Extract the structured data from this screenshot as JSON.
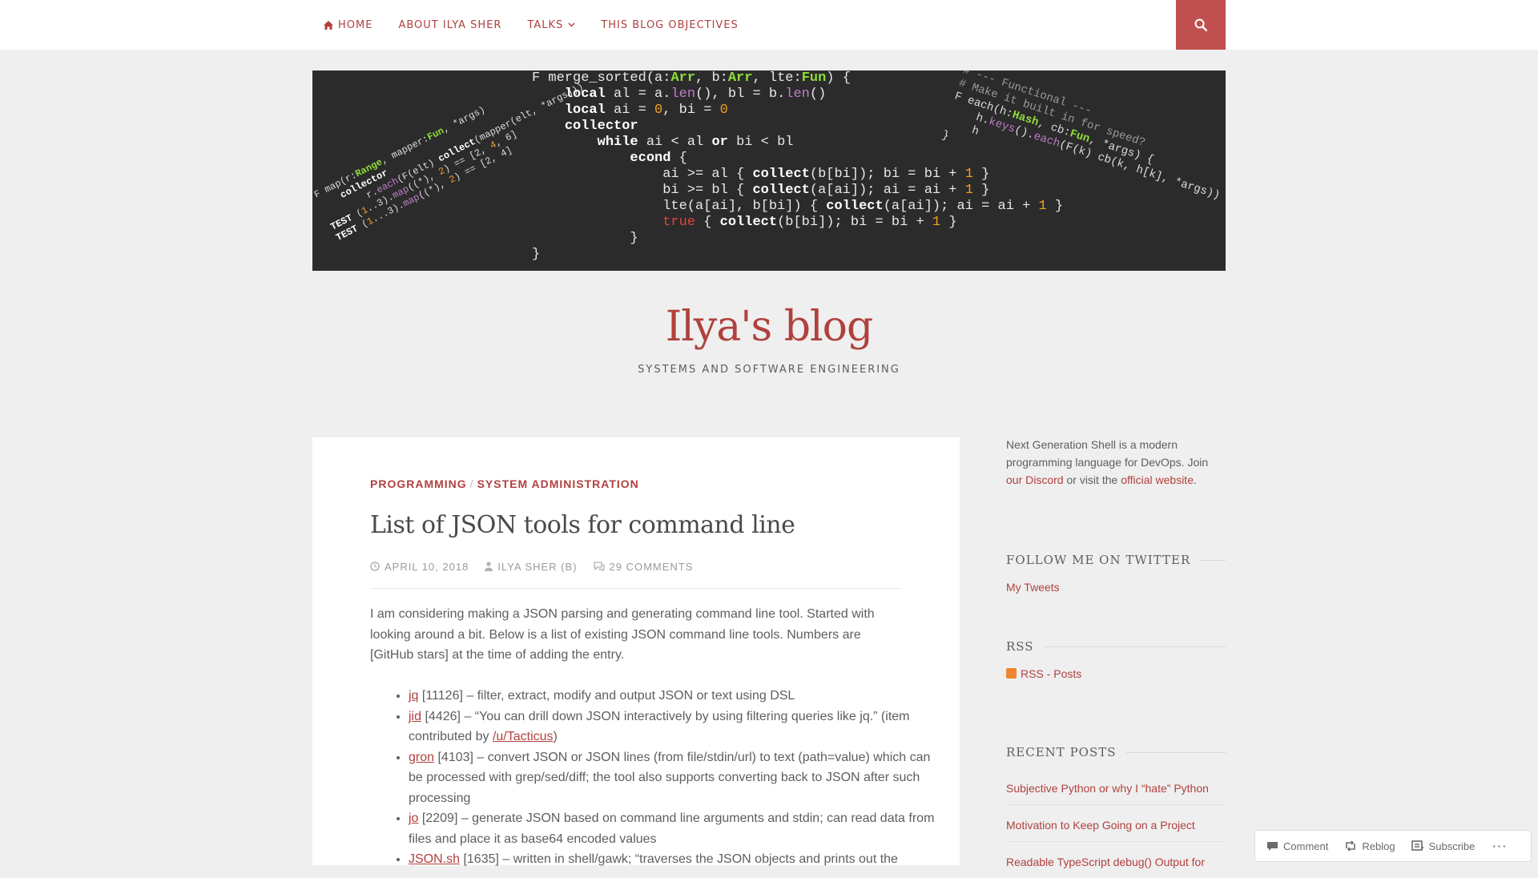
{
  "nav": {
    "items": [
      {
        "icon": "home-icon",
        "label": "HOME"
      },
      {
        "label": "ABOUT ILYA SHER"
      },
      {
        "label": "TALKS"
      },
      {
        "label": "THIS BLOG OBJECTIVES"
      }
    ],
    "search_icon": "search-icon"
  },
  "header_code": {
    "main": [
      "F merge_sorted(a:Arr, b:Arr, lte:Fun) {",
      "    local al = a.len(), bl = b.len()",
      "    local ai = 0, bi = 0",
      "    collector",
      "        while ai < al or bi < bl",
      "            econd {",
      "                ai >= al { collect(b[bi]); bi = bi + 1 }",
      "                bi >= bl { collect(a[ai]); ai = ai + 1 }",
      "                lte(a[ai], b[bi]) { collect(a[ai]); ai = ai + 1 }",
      "                true { collect(b[bi]); bi = bi + 1 }",
      "            }",
      "}"
    ],
    "left": [
      "F map(r:Range, mapper:Fun, *args)",
      "    collector",
      "        r.each(F(elt) collect(mapper(elt, *args)))",
      "TEST (1..3).map((*), 2) == [2, 4, 6]",
      "TEST (1...3).map((*), 2) == [2, 4]"
    ],
    "right": [
      "# --- Functional ---",
      "# Make it built in for speed?",
      "F each(h:Hash, cb:Fun, *args) {",
      "    h.keys().each(F(k) cb(k, h[k], *args))",
      "    h",
      "}"
    ]
  },
  "site": {
    "title": "Ilya's blog",
    "tagline": "SYSTEMS AND SOFTWARE ENGINEERING"
  },
  "post": {
    "categories": [
      "PROGRAMMING",
      "SYSTEM ADMINISTRATION"
    ],
    "category_separator": "/",
    "title": "List of JSON tools for command line",
    "date": "APRIL 10, 2018",
    "author": "ILYA SHER (B)",
    "comments": "29 COMMENTS",
    "intro": "I am considering making a JSON parsing and generating command line tool. Started with looking around a bit. Below is a list of existing JSON command line tools. Numbers are [GitHub stars] at the time of adding the entry.",
    "tools": [
      {
        "name": "jq",
        "text": " [11126] – filter, extract, modify and output JSON or text using DSL"
      },
      {
        "name": "jid",
        "text": " [4426] – “You can drill down JSON interactively by using filtering queries like jq.” (item contributed by ",
        "link2": "/u/Tacticus",
        "tail": ")"
      },
      {
        "name": "gron",
        "text": " [4103] – convert JSON or JSON lines (from file/stdin/url) to text (path=value) which can be processed with grep/sed/diff; the tool also supports converting back to JSON after such processing"
      },
      {
        "name": "jo",
        "text": " [2209] – generate JSON based on command line arguments and stdin; can read data from files and place it as base64 encoded values"
      },
      {
        "name": "JSON.sh",
        "text": " [1635] – written in shell/gawk; “traverses the JSON objects and prints out the"
      }
    ]
  },
  "sidebar": {
    "promo_text": "Next Generation Shell is a modern programming language for DevOps. Join ",
    "promo_link1": "our Discord",
    "promo_mid": " or visit the ",
    "promo_link2": "official website",
    "promo_end": ".",
    "twitter_title": "FOLLOW ME ON TWITTER",
    "twitter_link": "My Tweets",
    "rss_title": "RSS",
    "rss_link": "RSS - Posts",
    "recent_title": "RECENT POSTS",
    "recent_posts": [
      "Subjective Python or why I “hate” Python",
      "Motivation to Keep Going on a Project",
      "Readable TypeScript debug() Output for"
    ]
  },
  "actionbar": {
    "comment": "Comment",
    "reblog": "Reblog",
    "subscribe": "Subscribe",
    "more": "···"
  },
  "colors": {
    "accent": "#b0413e",
    "search_bg": "#c0504e",
    "page_bg": "#efefef",
    "header_bg": "#2b2b2b",
    "code_type": "#8fdc3a",
    "code_number": "#f0a020"
  }
}
